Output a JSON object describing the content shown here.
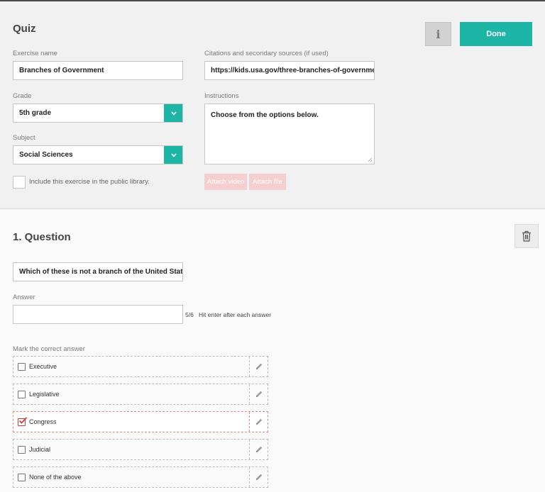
{
  "header": {
    "title": "Quiz",
    "info_label": "i",
    "done_label": "Done"
  },
  "form": {
    "exercise_name_label": "Exercise name",
    "exercise_name_value": "Branches of Government",
    "citations_label": "Citations and secondary sources (if used)",
    "citations_value": "https://kids.usa.gov/three-branches-of-government",
    "grade_label": "Grade",
    "grade_value": "5th grade",
    "instructions_label": "Instructions",
    "instructions_value": "Choose from the options below.",
    "subject_label": "Subject",
    "subject_value": "Social Sciences",
    "public_library_label": "Include this exercise in the public library.",
    "public_library_checked": false,
    "attach_video_label": "Attach video",
    "attach_file_label": "Attach file"
  },
  "question": {
    "title": "1. Question",
    "text": "Which of these is not a branch of the United States government?",
    "answer_label": "Answer",
    "answer_value": "",
    "answer_count": "5/6",
    "answer_hint": "Hit enter after each answer",
    "mark_correct_label": "Mark the correct answer",
    "options": [
      {
        "label": "Executive",
        "correct": false
      },
      {
        "label": "Legislative",
        "correct": false
      },
      {
        "label": "Congress",
        "correct": true
      },
      {
        "label": "Judicial",
        "correct": false
      },
      {
        "label": "None of the above",
        "correct": false
      }
    ]
  },
  "colors": {
    "accent": "#1db5a6",
    "correct": "#d23b3b",
    "attach_disabled": "#f5cfcf"
  },
  "icons": {
    "info": "info-icon",
    "dropdown": "chevron-down-icon",
    "trash": "trash-icon",
    "edit": "pencil-icon",
    "checkbox": "checkbox-icon",
    "resize": "resize-handle-icon"
  }
}
